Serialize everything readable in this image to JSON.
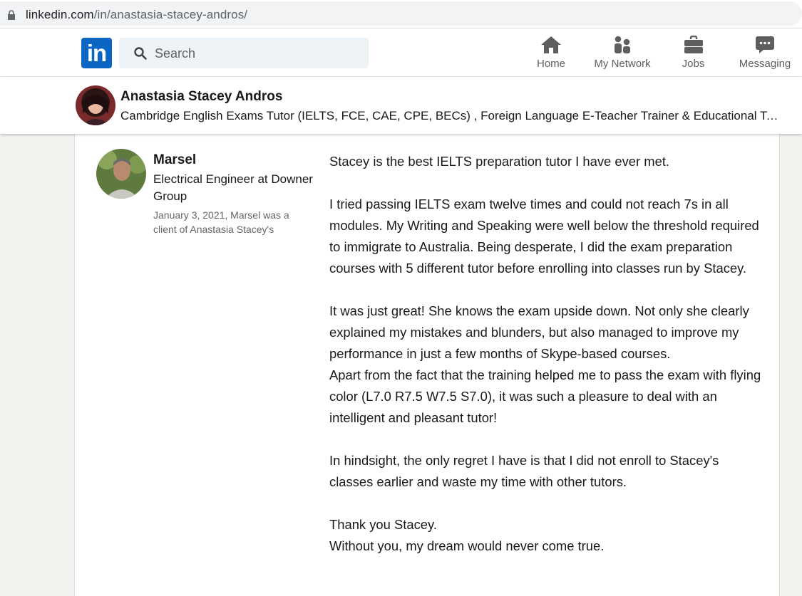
{
  "browser": {
    "url_host": "linkedin.com",
    "url_path": "/in/anastasia-stacey-andros/"
  },
  "nav": {
    "logo_text": "in",
    "search_placeholder": "Search",
    "items": [
      {
        "label": "Home",
        "icon": "home-icon"
      },
      {
        "label": "My Network",
        "icon": "network-icon"
      },
      {
        "label": "Jobs",
        "icon": "briefcase-icon"
      },
      {
        "label": "Messaging",
        "icon": "messaging-icon"
      }
    ]
  },
  "profile": {
    "name": "Anastasia Stacey Andros",
    "headline": "Cambridge English Exams Tutor (IELTS, FCE, CAE, CPE, BECs) , Foreign Language E-Teacher Trainer & Educational Techn..."
  },
  "recommendation": {
    "name": "Marsel",
    "title": "Electrical Engineer at Downer Group",
    "meta": "January 3, 2021, Marsel was a client of Anastasia Stacey's",
    "paragraphs": [
      "Stacey is the best IELTS preparation tutor I have ever met.",
      "I tried passing IELTS exam twelve times and could not reach 7s in all modules. My Writing and Speaking were well below the threshold required to immigrate to Australia. Being desperate, I did the exam preparation courses with 5 different tutor before enrolling into classes run by Stacey.",
      "It was just great! She knows the exam upside down. Not only she clearly explained my mistakes and blunders, but also managed to improve my performance in just a few months of Skype-based courses.",
      "Apart from the fact that the training helped me to pass the exam with flying color (L7.0 R7.5 W7.5 S7.0), it was such a pleasure to deal with an intelligent and pleasant tutor!",
      "In hindsight, the only regret I have is that I did not enroll to Stacey's classes earlier and waste my time with other tutors.",
      "Thank you Stacey.",
      "Without you, my dream would never come true."
    ]
  },
  "colors": {
    "brand": "#0a66c2",
    "nav_text": "#5e5e5e",
    "page_bg": "#f3f2ef"
  }
}
